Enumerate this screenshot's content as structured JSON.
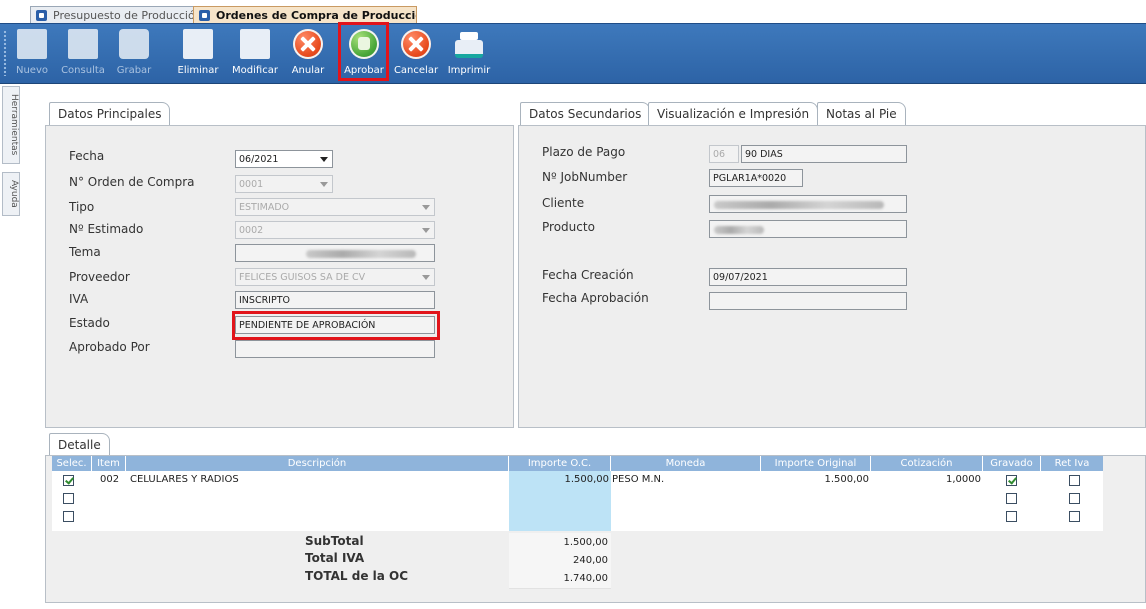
{
  "doc_tabs": [
    {
      "label": "Presupuesto de Producción",
      "active": false
    },
    {
      "label": "Ordenes de Compra de Producción",
      "active": true
    }
  ],
  "toolbar": {
    "nuevo": "Nuevo",
    "consulta": "Consulta",
    "grabar": "Grabar",
    "eliminar": "Eliminar",
    "modificar": "Modificar",
    "anular": "Anular",
    "aprobar": "Aprobar",
    "cancelar": "Cancelar",
    "imprimir": "Imprimir"
  },
  "side_tabs": {
    "herramientas": "Herramientas",
    "ayuda": "Ayuda"
  },
  "principal": {
    "tab": "Datos Principales",
    "fecha_label": "Fecha",
    "fecha": "06/2021",
    "orden_label": "N° Orden de Compra",
    "orden": "0001",
    "tipo_label": "Tipo",
    "tipo": "ESTIMADO",
    "estimado_label": "Nº Estimado",
    "estimado": "0002",
    "tema_label": "Tema",
    "tema": "",
    "proveedor_label": "Proveedor",
    "proveedor": "FELICES GUISOS SA DE CV",
    "iva_label": "IVA",
    "iva": "INSCRIPTO",
    "estado_label": "Estado",
    "estado": "PENDIENTE DE APROBACIÓN",
    "aprobado_label": "Aprobado Por",
    "aprobado": ""
  },
  "secundarios": {
    "tabs": [
      "Datos Secundarios",
      "Visualización e Impresión",
      "Notas al Pie"
    ],
    "plazo_label": "Plazo de Pago",
    "plazo_code": "06",
    "plazo": "90 DIAS",
    "job_label": "Nº JobNumber",
    "job": "PGLAR1A*0020",
    "cliente_label": "Cliente",
    "cliente": "",
    "producto_label": "Producto",
    "producto": "",
    "creacion_label": "Fecha Creación",
    "creacion": "09/07/2021",
    "aprobacion_label": "Fecha Aprobación",
    "aprobacion": ""
  },
  "detalle": {
    "tab": "Detalle",
    "columns": [
      "Selec.",
      "Item",
      "Descripción",
      "Importe O.C.",
      "Moneda",
      "Importe Original",
      "Cotización",
      "Gravado",
      "Ret Iva"
    ],
    "rows": [
      {
        "selected": true,
        "item": "002",
        "descripcion": "CELULARES Y RADIOS",
        "importe": "1.500,00",
        "moneda": "PESO M.N.",
        "original": "1.500,00",
        "cotizacion": "1,0000",
        "gravado": true,
        "ret_iva": false
      },
      {
        "selected": false,
        "item": "",
        "descripcion": "",
        "importe": "",
        "moneda": "",
        "original": "",
        "cotizacion": "",
        "gravado": false,
        "ret_iva": false
      },
      {
        "selected": false,
        "item": "",
        "descripcion": "",
        "importe": "",
        "moneda": "",
        "original": "",
        "cotizacion": "",
        "gravado": false,
        "ret_iva": false
      }
    ],
    "totals": [
      {
        "label": "SubTotal",
        "value": "1.500,00"
      },
      {
        "label": "Total IVA",
        "value": "240,00"
      },
      {
        "label": "TOTAL de la OC",
        "value": "1.740,00"
      }
    ]
  },
  "colors": {
    "toolbar": "#3a72b4",
    "grid_header": "#8fb4db",
    "highlight": "#e1141b",
    "importe_col": "#bde3f6"
  }
}
